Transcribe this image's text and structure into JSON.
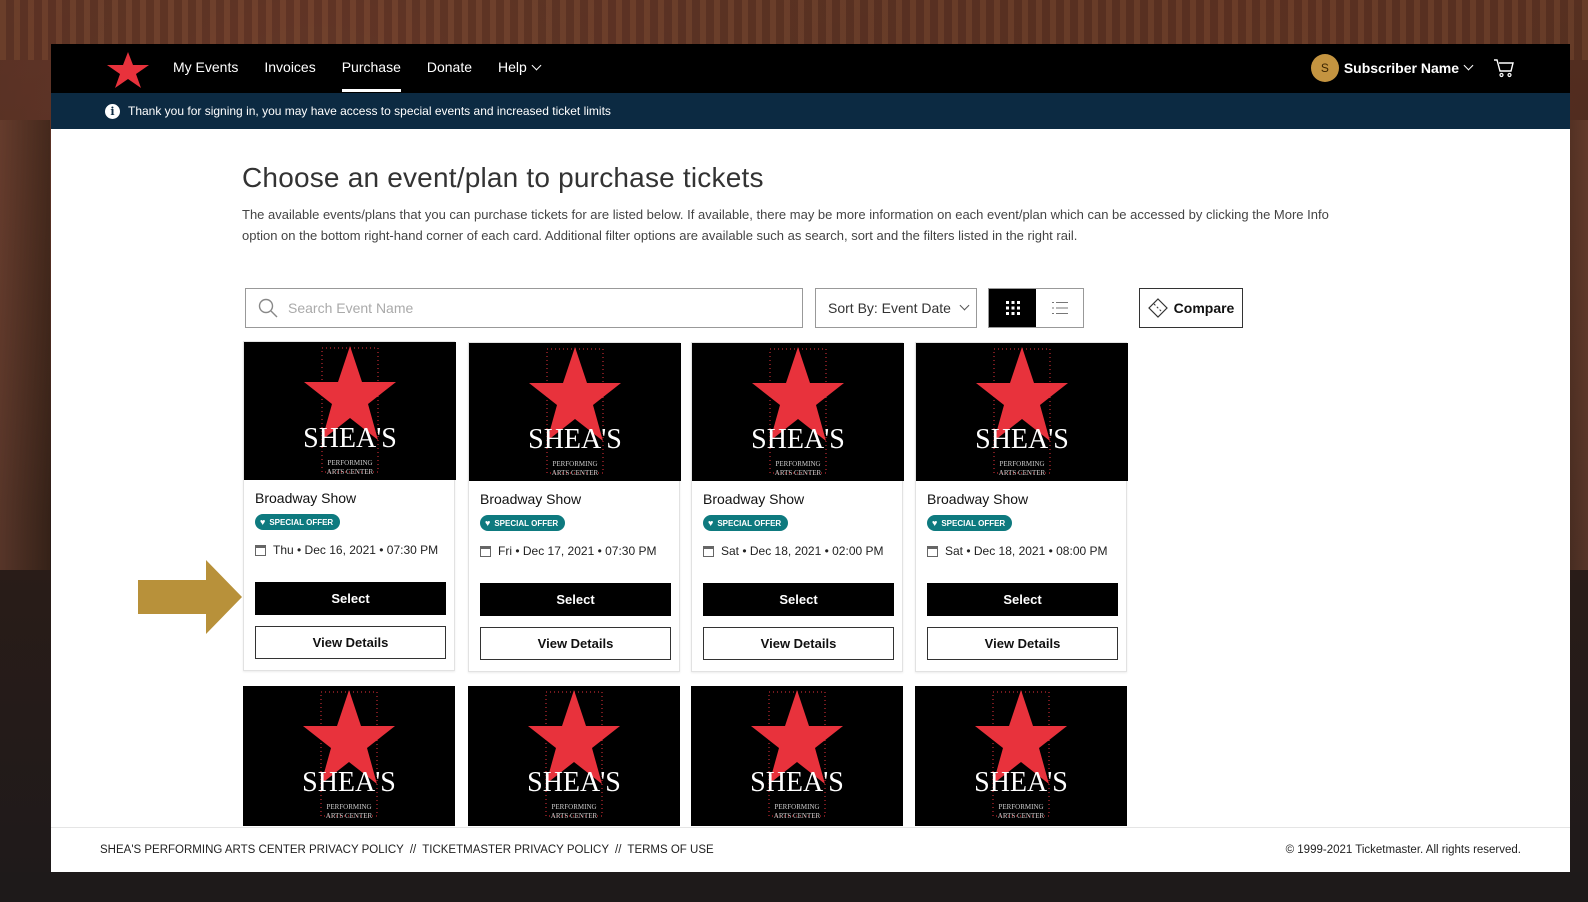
{
  "nav": {
    "links": [
      {
        "label": "My Events",
        "active": false
      },
      {
        "label": "Invoices",
        "active": false
      },
      {
        "label": "Purchase",
        "active": true
      },
      {
        "label": "Donate",
        "active": false
      },
      {
        "label": "Help",
        "active": false,
        "dropdown": true
      }
    ],
    "account": {
      "avatar_letter": "S",
      "name": "Subscriber Name"
    },
    "cart_icon": "cart-icon"
  },
  "banner": {
    "text": "Thank you  for signing in, you may have access to special events and increased ticket limits"
  },
  "page": {
    "title": "Choose an event/plan to purchase tickets",
    "description": "The available events/plans that you can purchase tickets for are listed below. If available, there may be more information on each event/plan which can be accessed by clicking the More Info option on the bottom right-hand corner of each card. Additional filter options are available such as search, sort and the filters listed in the right rail."
  },
  "toolbar": {
    "search_placeholder": "Search Event Name",
    "sort_label": "Sort By: Event Date",
    "view": "grid",
    "compare_label": "Compare"
  },
  "cards": [
    {
      "title": "Broadway Show",
      "badge": "SPECIAL OFFER",
      "date": "Thu • Dec 16, 2021 • 07:30 PM",
      "select": "Select",
      "details": "View Details"
    },
    {
      "title": "Broadway Show",
      "badge": "SPECIAL OFFER",
      "date": "Fri • Dec 17, 2021 • 07:30 PM",
      "select": "Select",
      "details": "View Details"
    },
    {
      "title": "Broadway Show",
      "badge": "SPECIAL OFFER",
      "date": "Sat • Dec 18, 2021 • 02:00 PM",
      "select": "Select",
      "details": "View Details"
    },
    {
      "title": "Broadway Show",
      "badge": "SPECIAL OFFER",
      "date": "Sat • Dec 18, 2021 • 08:00 PM",
      "select": "Select",
      "details": "View Details"
    }
  ],
  "logo_text": {
    "name": "SHEA'S",
    "line1": "PERFORMING",
    "line2": "ARTS CENTER"
  },
  "footer": {
    "links": [
      "SHEA'S PERFORMING ARTS CENTER PRIVACY POLICY",
      "TICKETMASTER PRIVACY POLICY",
      "TERMS OF USE"
    ],
    "separator": "//",
    "copyright": "© 1999-2021 Ticketmaster. All rights reserved."
  },
  "colors": {
    "nav_bg": "#000000",
    "banner_bg": "#0c2a42",
    "badge": "#0e7a7f",
    "avatar": "#c49440",
    "arrow": "#b8913a",
    "star": "#e8323c"
  }
}
